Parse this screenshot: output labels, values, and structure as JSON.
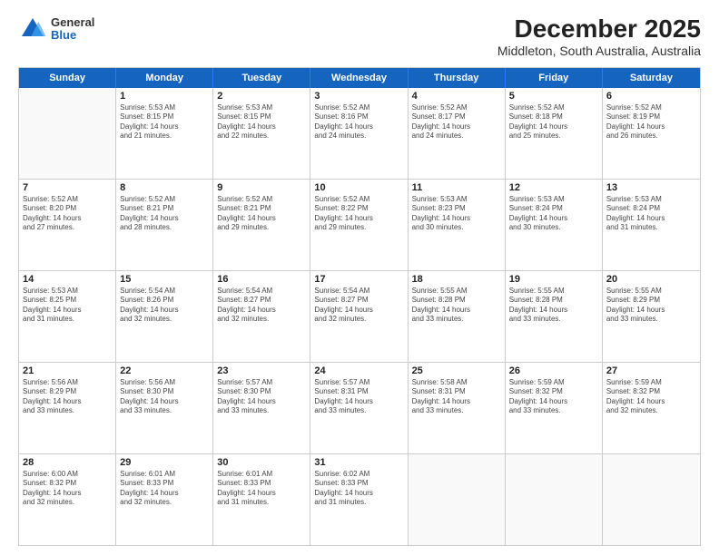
{
  "logo": {
    "general": "General",
    "blue": "Blue"
  },
  "title": "December 2025",
  "subtitle": "Middleton, South Australia, Australia",
  "days": [
    "Sunday",
    "Monday",
    "Tuesday",
    "Wednesday",
    "Thursday",
    "Friday",
    "Saturday"
  ],
  "rows": [
    [
      {
        "day": "",
        "empty": true
      },
      {
        "day": "1",
        "lines": [
          "Sunrise: 5:53 AM",
          "Sunset: 8:15 PM",
          "Daylight: 14 hours",
          "and 21 minutes."
        ]
      },
      {
        "day": "2",
        "lines": [
          "Sunrise: 5:53 AM",
          "Sunset: 8:15 PM",
          "Daylight: 14 hours",
          "and 22 minutes."
        ]
      },
      {
        "day": "3",
        "lines": [
          "Sunrise: 5:52 AM",
          "Sunset: 8:16 PM",
          "Daylight: 14 hours",
          "and 24 minutes."
        ]
      },
      {
        "day": "4",
        "lines": [
          "Sunrise: 5:52 AM",
          "Sunset: 8:17 PM",
          "Daylight: 14 hours",
          "and 24 minutes."
        ]
      },
      {
        "day": "5",
        "lines": [
          "Sunrise: 5:52 AM",
          "Sunset: 8:18 PM",
          "Daylight: 14 hours",
          "and 25 minutes."
        ]
      },
      {
        "day": "6",
        "lines": [
          "Sunrise: 5:52 AM",
          "Sunset: 8:19 PM",
          "Daylight: 14 hours",
          "and 26 minutes."
        ]
      }
    ],
    [
      {
        "day": "7",
        "lines": [
          "Sunrise: 5:52 AM",
          "Sunset: 8:20 PM",
          "Daylight: 14 hours",
          "and 27 minutes."
        ]
      },
      {
        "day": "8",
        "lines": [
          "Sunrise: 5:52 AM",
          "Sunset: 8:21 PM",
          "Daylight: 14 hours",
          "and 28 minutes."
        ]
      },
      {
        "day": "9",
        "lines": [
          "Sunrise: 5:52 AM",
          "Sunset: 8:21 PM",
          "Daylight: 14 hours",
          "and 29 minutes."
        ]
      },
      {
        "day": "10",
        "lines": [
          "Sunrise: 5:52 AM",
          "Sunset: 8:22 PM",
          "Daylight: 14 hours",
          "and 29 minutes."
        ]
      },
      {
        "day": "11",
        "lines": [
          "Sunrise: 5:53 AM",
          "Sunset: 8:23 PM",
          "Daylight: 14 hours",
          "and 30 minutes."
        ]
      },
      {
        "day": "12",
        "lines": [
          "Sunrise: 5:53 AM",
          "Sunset: 8:24 PM",
          "Daylight: 14 hours",
          "and 30 minutes."
        ]
      },
      {
        "day": "13",
        "lines": [
          "Sunrise: 5:53 AM",
          "Sunset: 8:24 PM",
          "Daylight: 14 hours",
          "and 31 minutes."
        ]
      }
    ],
    [
      {
        "day": "14",
        "lines": [
          "Sunrise: 5:53 AM",
          "Sunset: 8:25 PM",
          "Daylight: 14 hours",
          "and 31 minutes."
        ]
      },
      {
        "day": "15",
        "lines": [
          "Sunrise: 5:54 AM",
          "Sunset: 8:26 PM",
          "Daylight: 14 hours",
          "and 32 minutes."
        ]
      },
      {
        "day": "16",
        "lines": [
          "Sunrise: 5:54 AM",
          "Sunset: 8:27 PM",
          "Daylight: 14 hours",
          "and 32 minutes."
        ]
      },
      {
        "day": "17",
        "lines": [
          "Sunrise: 5:54 AM",
          "Sunset: 8:27 PM",
          "Daylight: 14 hours",
          "and 32 minutes."
        ]
      },
      {
        "day": "18",
        "lines": [
          "Sunrise: 5:55 AM",
          "Sunset: 8:28 PM",
          "Daylight: 14 hours",
          "and 33 minutes."
        ]
      },
      {
        "day": "19",
        "lines": [
          "Sunrise: 5:55 AM",
          "Sunset: 8:28 PM",
          "Daylight: 14 hours",
          "and 33 minutes."
        ]
      },
      {
        "day": "20",
        "lines": [
          "Sunrise: 5:55 AM",
          "Sunset: 8:29 PM",
          "Daylight: 14 hours",
          "and 33 minutes."
        ]
      }
    ],
    [
      {
        "day": "21",
        "lines": [
          "Sunrise: 5:56 AM",
          "Sunset: 8:29 PM",
          "Daylight: 14 hours",
          "and 33 minutes."
        ]
      },
      {
        "day": "22",
        "lines": [
          "Sunrise: 5:56 AM",
          "Sunset: 8:30 PM",
          "Daylight: 14 hours",
          "and 33 minutes."
        ]
      },
      {
        "day": "23",
        "lines": [
          "Sunrise: 5:57 AM",
          "Sunset: 8:30 PM",
          "Daylight: 14 hours",
          "and 33 minutes."
        ]
      },
      {
        "day": "24",
        "lines": [
          "Sunrise: 5:57 AM",
          "Sunset: 8:31 PM",
          "Daylight: 14 hours",
          "and 33 minutes."
        ]
      },
      {
        "day": "25",
        "lines": [
          "Sunrise: 5:58 AM",
          "Sunset: 8:31 PM",
          "Daylight: 14 hours",
          "and 33 minutes."
        ]
      },
      {
        "day": "26",
        "lines": [
          "Sunrise: 5:59 AM",
          "Sunset: 8:32 PM",
          "Daylight: 14 hours",
          "and 33 minutes."
        ]
      },
      {
        "day": "27",
        "lines": [
          "Sunrise: 5:59 AM",
          "Sunset: 8:32 PM",
          "Daylight: 14 hours",
          "and 32 minutes."
        ]
      }
    ],
    [
      {
        "day": "28",
        "lines": [
          "Sunrise: 6:00 AM",
          "Sunset: 8:32 PM",
          "Daylight: 14 hours",
          "and 32 minutes."
        ]
      },
      {
        "day": "29",
        "lines": [
          "Sunrise: 6:01 AM",
          "Sunset: 8:33 PM",
          "Daylight: 14 hours",
          "and 32 minutes."
        ]
      },
      {
        "day": "30",
        "lines": [
          "Sunrise: 6:01 AM",
          "Sunset: 8:33 PM",
          "Daylight: 14 hours",
          "and 31 minutes."
        ]
      },
      {
        "day": "31",
        "lines": [
          "Sunrise: 6:02 AM",
          "Sunset: 8:33 PM",
          "Daylight: 14 hours",
          "and 31 minutes."
        ]
      },
      {
        "day": "",
        "empty": true
      },
      {
        "day": "",
        "empty": true
      },
      {
        "day": "",
        "empty": true
      }
    ]
  ]
}
